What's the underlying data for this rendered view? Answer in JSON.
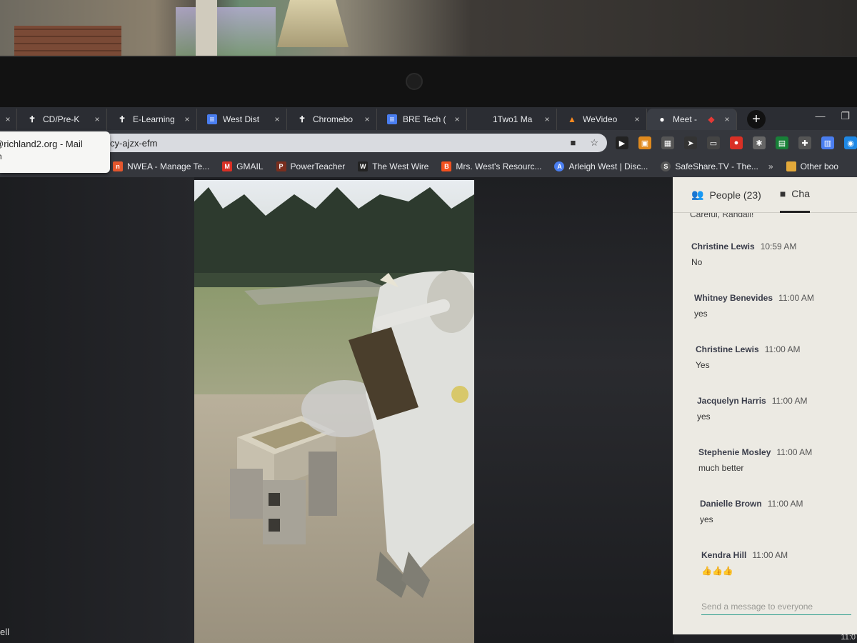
{
  "tabs": [
    {
      "title": "",
      "icon": "tab-icon"
    },
    {
      "title": "CD/Pre-K",
      "icon": "cross-icon"
    },
    {
      "title": "E-Learning",
      "icon": "cross-icon"
    },
    {
      "title": "West Dist",
      "icon": "doc-icon"
    },
    {
      "title": "Chromebo",
      "icon": "cross-icon"
    },
    {
      "title": "BRE Tech (",
      "icon": "doc-icon"
    },
    {
      "title": "1Two1 Ma",
      "icon": "blank-icon"
    },
    {
      "title": "WeVideo",
      "icon": "wevideo-icon"
    },
    {
      "title": "Meet -",
      "icon": "meet-icon"
    }
  ],
  "tab_close_symbol": "×",
  "new_tab_symbol": "+",
  "omnibox": {
    "url": "cy-ajzx-efm"
  },
  "tooltip": {
    "line1": "@richland2.org - Mail",
    "line2": "n"
  },
  "bookmarks": [
    {
      "label": "NWEA - Manage Te...",
      "icon_text": "n",
      "color": "#e4572e"
    },
    {
      "label": "GMAIL",
      "icon_text": "M",
      "color": "#d93025"
    },
    {
      "label": "PowerTeacher",
      "icon_text": "P",
      "color": "#7a2e1e"
    },
    {
      "label": "The West Wire",
      "icon_text": "W",
      "color": "#222222"
    },
    {
      "label": "Mrs. West's Resourc...",
      "icon_text": "B",
      "color": "#f4511e"
    },
    {
      "label": "Arleigh West | Disc...",
      "icon_text": "A",
      "color": "#4a7ef0"
    },
    {
      "label": "SafeShare.TV - The...",
      "icon_text": "S",
      "color": "#555555"
    }
  ],
  "bookmarks_more": "»",
  "other_bookmarks": "Other boo",
  "panel": {
    "people_label": "People (23)",
    "chat_label": "Cha",
    "cut_message": "Careful, Randall!",
    "composer_placeholder": "Send a message to everyone"
  },
  "messages": [
    {
      "name": "Christine Lewis",
      "time": "10:59 AM",
      "text": "No"
    },
    {
      "name": "Whitney Benevides",
      "time": "11:00 AM",
      "text": "yes"
    },
    {
      "name": "Christine Lewis",
      "time": "11:00 AM",
      "text": "Yes"
    },
    {
      "name": "Jacquelyn Harris",
      "time": "11:00 AM",
      "text": "yes"
    },
    {
      "name": "Stephenie Mosley",
      "time": "11:00 AM",
      "text": "much better"
    },
    {
      "name": "Danielle Brown",
      "time": "11:00 AM",
      "text": "yes"
    },
    {
      "name": "Kendra Hill",
      "time": "11:00 AM",
      "text": "👍👍👍"
    }
  ],
  "bottom_left_text": "ell",
  "bottom_right_text": "11:0"
}
